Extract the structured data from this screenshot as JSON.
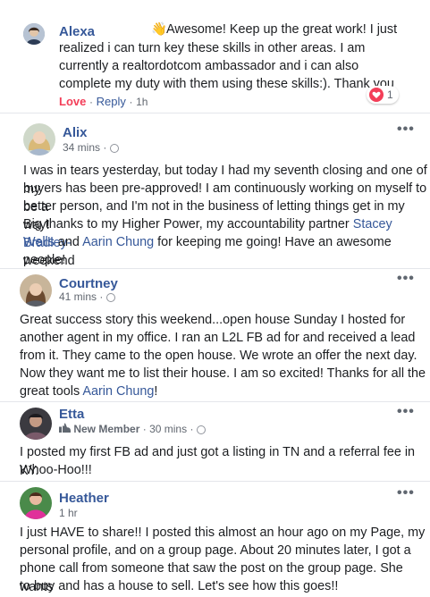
{
  "reply": {
    "author": "Alexa",
    "emoji": "👋",
    "text": "Awesome! Keep up the great work! I just realized i can turn key these skills in other areas. I am currently a realtordotcom ambassador and i can also complete my duty with them using these skills:). Thank you",
    "line1": "Awesome! Keep up the great work! I just",
    "line2": "realized i can turn key these skills in other areas. I am",
    "line3": "currently a realtordotcom ambassador and i can also",
    "line4": "complete my duty with them using these skills:). Thank you",
    "love_label": "Love",
    "reply_label": "Reply",
    "time": "1h",
    "reaction_count": "1",
    "colors": {
      "love": "#f33e58"
    }
  },
  "posts": [
    {
      "author": "Alix",
      "time": "34 mins",
      "lines": [
        "I was in tears yesterday, but today I had my seventh closing and one of my",
        "buyers has been pre-approved! I am continuously working on myself to be a",
        "better person, and I'm not in the business of letting things get in my way!",
        "Big thanks to my Higher Power, my accountability partner ",
        "Wells",
        " and ",
        "Aarin Chung",
        " for keeping me going! Have an awesome weekend",
        "people!"
      ],
      "mention1_part1": "Stacey Bradley-",
      "mentions": [
        "Stacey Bradley-Wells",
        "Aarin Chung"
      ]
    },
    {
      "author": "Courtney",
      "time": "41 mins",
      "lines": [
        "Great success story this weekend...open house Sunday I hosted for",
        "another agent in my office. I ran an L2L FB ad for and received a lead",
        "from it. They came to the open house. We wrote an offer the next day.",
        "Now they want me to list their house. I am so excited! Thanks for all the",
        "great tools ",
        "Aarin Chung",
        "!"
      ]
    },
    {
      "author": "Etta",
      "badge": "New Member",
      "time": "30 mins",
      "lines": [
        "I posted my first FB ad and just got a listing in TN and a referral fee in KY.",
        "Whoo-Hoo!!!"
      ]
    },
    {
      "author": "Heather",
      "time": "1 hr",
      "lines": [
        "I just HAVE to share!! I posted this almost an hour ago on my Page, my",
        "personal profile, and on a group page. About 20 minutes later, I got a",
        "phone call from someone that saw the post on the group page. She wants",
        "to buy and has a house to sell. Let's see how this goes!!"
      ]
    }
  ],
  "ui": {
    "more_label": "•••",
    "separator": "·",
    "accent": "#365899"
  }
}
